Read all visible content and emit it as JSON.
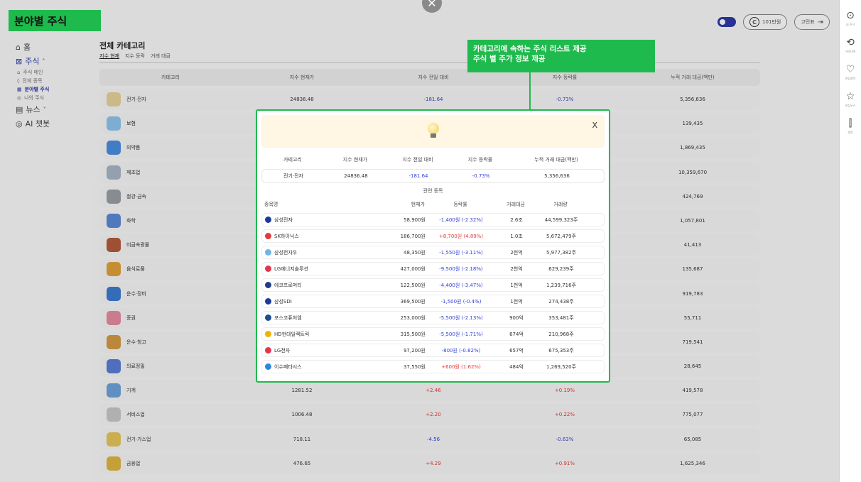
{
  "page_label": "분야별 주식",
  "header": {
    "alert_toggle": "on",
    "points_label": "101만원",
    "logout_label": "고민표"
  },
  "sidebar": {
    "items": [
      {
        "label": "홈",
        "icon": "home-icon"
      },
      {
        "label": "주식",
        "icon": "chart-icon",
        "expanded": true
      },
      {
        "label": "주식 메인",
        "icon": "house-icon"
      },
      {
        "label": "전체 종목",
        "icon": "grid-icon"
      },
      {
        "label": "분야별 주식",
        "icon": "table-icon",
        "active": true
      },
      {
        "label": "나의 주식",
        "icon": "coin-icon"
      },
      {
        "label": "뉴스",
        "icon": "news-icon"
      },
      {
        "label": "AI 챗봇",
        "icon": "bot-icon"
      }
    ]
  },
  "rail": {
    "items": [
      {
        "label": "내 주식",
        "icon": "coin-icon"
      },
      {
        "label": "거래내역",
        "icon": "history-icon"
      },
      {
        "label": "관심종목",
        "icon": "heart-icon"
      },
      {
        "label": "관심뉴스",
        "icon": "star-icon"
      },
      {
        "label": "랭킹",
        "icon": "ranking-icon"
      }
    ]
  },
  "main": {
    "title": "전체 카테고리",
    "tabs": [
      "지수 현재",
      "지수 등락",
      "거래 대금"
    ],
    "columns": [
      "카테고리",
      "지수 현재가",
      "지수 전일 대비",
      "지수 등락률",
      "누적 거래 대금(백만)"
    ],
    "rows": [
      {
        "name": "전기·전자",
        "color": "#e8d39a",
        "price": "24836.48",
        "change": "-181.64",
        "rate": "-0.73%",
        "volume": "5,356,636",
        "dir": "down"
      },
      {
        "name": "보험",
        "color": "#8fc7ef",
        "price": "",
        "change": "",
        "rate": "",
        "volume": "139,435",
        "dir": "down"
      },
      {
        "name": "의약품",
        "color": "#4a8fe0",
        "price": "",
        "change": "",
        "rate": "",
        "volume": "1,869,435",
        "dir": "down"
      },
      {
        "name": "제조업",
        "color": "#a8b8c8",
        "price": "",
        "change": "",
        "rate": "",
        "volume": "10,359,670",
        "dir": "down"
      },
      {
        "name": "철강·금속",
        "color": "#9aa0a6",
        "price": "",
        "change": "",
        "rate": "",
        "volume": "424,769",
        "dir": "down"
      },
      {
        "name": "화학",
        "color": "#5b8ad6",
        "price": "",
        "change": "",
        "rate": "",
        "volume": "1,057,801",
        "dir": "down"
      },
      {
        "name": "비금속광물",
        "color": "#b45c3c",
        "price": "",
        "change": "",
        "rate": "",
        "volume": "41,413",
        "dir": "down"
      },
      {
        "name": "음식료품",
        "color": "#e2a23a",
        "price": "",
        "change": "",
        "rate": "",
        "volume": "135,687",
        "dir": "down"
      },
      {
        "name": "운수·장비",
        "color": "#3d7bd1",
        "price": "",
        "change": "",
        "rate": "",
        "volume": "919,783",
        "dir": "down"
      },
      {
        "name": "증권",
        "color": "#e88da2",
        "price": "",
        "change": "",
        "rate": "",
        "volume": "55,711",
        "dir": "down"
      },
      {
        "name": "운수·창고",
        "color": "#d49a45",
        "price": "",
        "change": "",
        "rate": "",
        "volume": "719,541",
        "dir": "down"
      },
      {
        "name": "의료정밀",
        "color": "#5a7fd6",
        "price": "",
        "change": "",
        "rate": "",
        "volume": "28,645",
        "dir": "down"
      },
      {
        "name": "기계",
        "color": "#6fa3dd",
        "price": "1281.52",
        "change": "+2.46",
        "rate": "+0.19%",
        "volume": "419,578",
        "dir": "up"
      },
      {
        "name": "서비스업",
        "color": "#c9c9c9",
        "price": "1006.48",
        "change": "+2.20",
        "rate": "+0.22%",
        "volume": "775,077",
        "dir": "up"
      },
      {
        "name": "전기·가스업",
        "color": "#e7c65a",
        "price": "718.11",
        "change": "-4.56",
        "rate": "-0.63%",
        "volume": "65,085",
        "dir": "down"
      },
      {
        "name": "금융업",
        "color": "#e0b840",
        "price": "476.65",
        "change": "+4.29",
        "rate": "+0.91%",
        "volume": "1,625,346",
        "dir": "up"
      }
    ]
  },
  "callout": {
    "line1": "카테고리에 속하는 주식 리스트 제공",
    "line2": "주식 별 주가 정보 제공"
  },
  "modal": {
    "close_label": "X",
    "summary_columns": [
      "카테고리",
      "지수 현재가",
      "지수 전일 대비",
      "지수 등락률",
      "누적 거래 대금(백만)"
    ],
    "summary": {
      "category": "전기·전자",
      "price": "24836.48",
      "change": "-181.64",
      "rate": "-0.73%",
      "volume": "5,356,636"
    },
    "section_title": "관련 종목",
    "stock_columns": [
      "종목명",
      "현재가",
      "등락률",
      "거래대금",
      "거래량"
    ],
    "stocks": [
      {
        "name": "삼성전자",
        "logo": "#1a3a9c",
        "price": "58,900원",
        "change": "-1,400원 (-2.32%)",
        "amount": "2.6조",
        "volume": "44,599,323주",
        "dir": "down"
      },
      {
        "name": "SK하이닉스",
        "logo": "#e23b3b",
        "price": "186,700원",
        "change": "+8,700원 (4.89%)",
        "amount": "1.0조",
        "volume": "5,672,479주",
        "dir": "up"
      },
      {
        "name": "삼성전자우",
        "logo": "#6fb3e8",
        "price": "48,350원",
        "change": "-1,550원 (-3.11%)",
        "amount": "2천억",
        "volume": "5,977,382주",
        "dir": "down"
      },
      {
        "name": "LG에너지솔루션",
        "logo": "#e2364e",
        "price": "427,000원",
        "change": "-9,500원 (-2.18%)",
        "amount": "2천억",
        "volume": "629,239주",
        "dir": "down"
      },
      {
        "name": "에코프로머티",
        "logo": "#1f3c88",
        "price": "122,500원",
        "change": "-4,400원 (-3.47%)",
        "amount": "1천억",
        "volume": "1,239,716주",
        "dir": "down"
      },
      {
        "name": "삼성SDI",
        "logo": "#1a3a9c",
        "price": "369,500원",
        "change": "-1,500원 (-0.4%)",
        "amount": "1천억",
        "volume": "274,438주",
        "dir": "down"
      },
      {
        "name": "포스코퓨처엠",
        "logo": "#1d4e8f",
        "price": "253,000원",
        "change": "-5,500원 (-2.13%)",
        "amount": "900억",
        "volume": "353,481주",
        "dir": "down"
      },
      {
        "name": "HD현대일렉트릭",
        "logo": "#f0b400",
        "price": "315,500원",
        "change": "-5,500원 (-1.71%)",
        "amount": "674억",
        "volume": "210,968주",
        "dir": "down"
      },
      {
        "name": "LG전자",
        "logo": "#e2364e",
        "price": "97,200원",
        "change": "-800원 (-0.82%)",
        "amount": "657억",
        "volume": "675,353주",
        "dir": "down"
      },
      {
        "name": "이수페타시스",
        "logo": "#2f86d8",
        "price": "37,550원",
        "change": "+600원 (1.62%)",
        "amount": "484억",
        "volume": "1,269,520주",
        "dir": "up"
      }
    ]
  }
}
